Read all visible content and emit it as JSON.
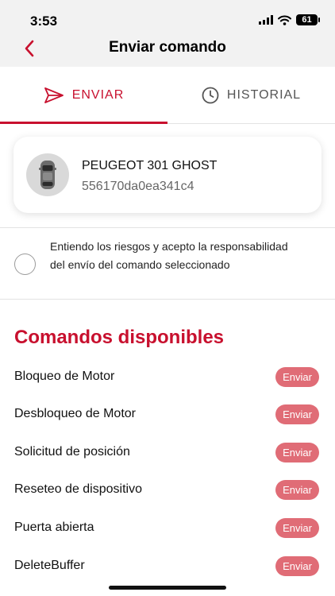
{
  "status_bar": {
    "time": "3:53",
    "battery": "61"
  },
  "nav": {
    "title": "Enviar comando"
  },
  "tabs": [
    {
      "label": "ENVIAR",
      "active": true
    },
    {
      "label": "HISTORIAL",
      "active": false
    }
  ],
  "vehicle": {
    "name": "PEUGEOT 301 GHOST",
    "id": "556170da0ea341c4",
    "icon": "car-icon"
  },
  "consent": {
    "text": "Entiendo los riesgos y acepto la responsabilidad del envío del comando seleccionado",
    "checked": false
  },
  "commands_section": {
    "title": "Comandos disponibles"
  },
  "commands": [
    {
      "label": "Bloqueo de Motor",
      "button": "Enviar"
    },
    {
      "label": "Desbloqueo de Motor",
      "button": "Enviar"
    },
    {
      "label": "Solicitud de posición",
      "button": "Enviar"
    },
    {
      "label": "Reseteo de dispositivo",
      "button": "Enviar"
    },
    {
      "label": "Puerta abierta",
      "button": "Enviar"
    },
    {
      "label": "DeleteBuffer",
      "button": "Enviar"
    }
  ],
  "colors": {
    "accent": "#c8102e",
    "button": "#e06c76"
  }
}
